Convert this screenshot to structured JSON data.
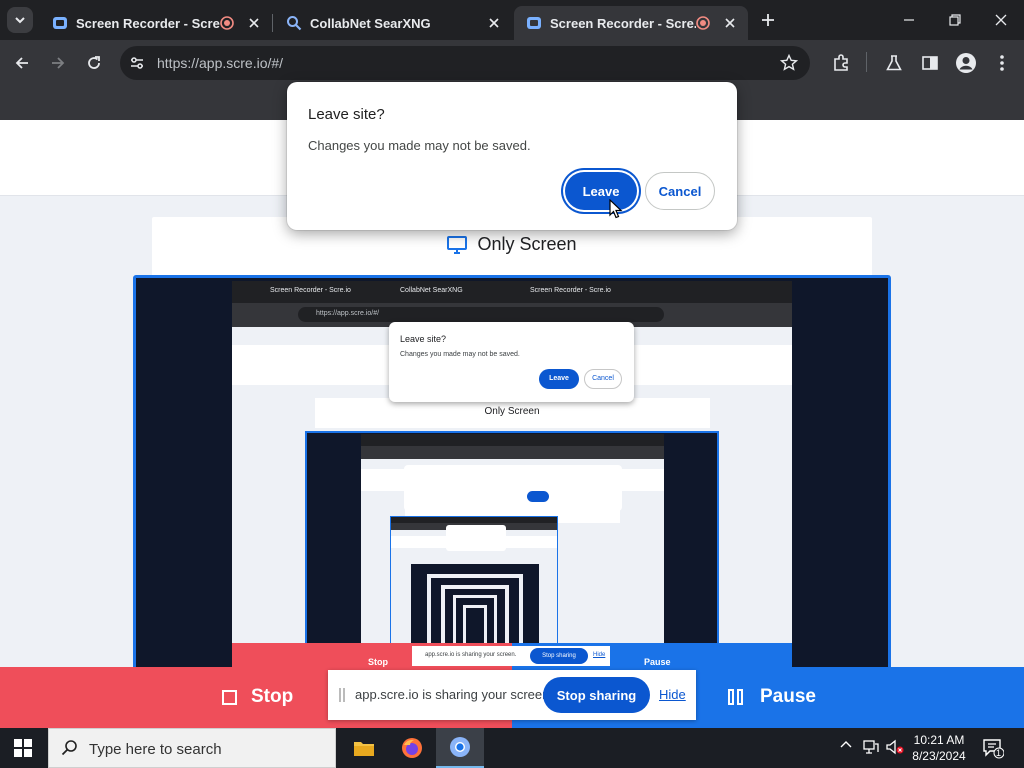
{
  "browser": {
    "tabs": [
      {
        "title": "Screen Recorder - Scre.io",
        "recording": true,
        "active": false
      },
      {
        "title": "CollabNet SearXNG",
        "recording": false,
        "active": false
      },
      {
        "title": "Screen Recorder - Scre.io",
        "recording": true,
        "active": true
      }
    ],
    "url": "https://app.scre.io/#/"
  },
  "page": {
    "only_screen_label": "Only Screen"
  },
  "dialog": {
    "title": "Leave site?",
    "message": "Changes you made may not be saved.",
    "leave_label": "Leave",
    "cancel_label": "Cancel"
  },
  "preview": {
    "tab1": "Screen Recorder - Scre.io",
    "tab2": "CollabNet SearXNG",
    "tab3": "Screen Recorder - Scre.io",
    "url": "https://app.scre.io/#/",
    "dialog_title": "Leave site?",
    "dialog_message": "Changes you made may not be saved.",
    "leave": "Leave",
    "cancel": "Cancel",
    "only_screen": "Only Screen",
    "stop": "Stop",
    "share_text": "app.scre.io is sharing your screen.",
    "stop_sharing": "Stop sharing",
    "hide": "Hide",
    "pause": "Pause"
  },
  "recorder": {
    "stop_label": "Stop",
    "pause_label": "Pause",
    "share_text": "app.scre.io is sharing your screen.",
    "stop_sharing_label": "Stop sharing",
    "hide_label": "Hide"
  },
  "taskbar": {
    "search_placeholder": "Type here to search",
    "time": "10:21 AM",
    "date": "8/23/2024",
    "notification_count": "1"
  }
}
